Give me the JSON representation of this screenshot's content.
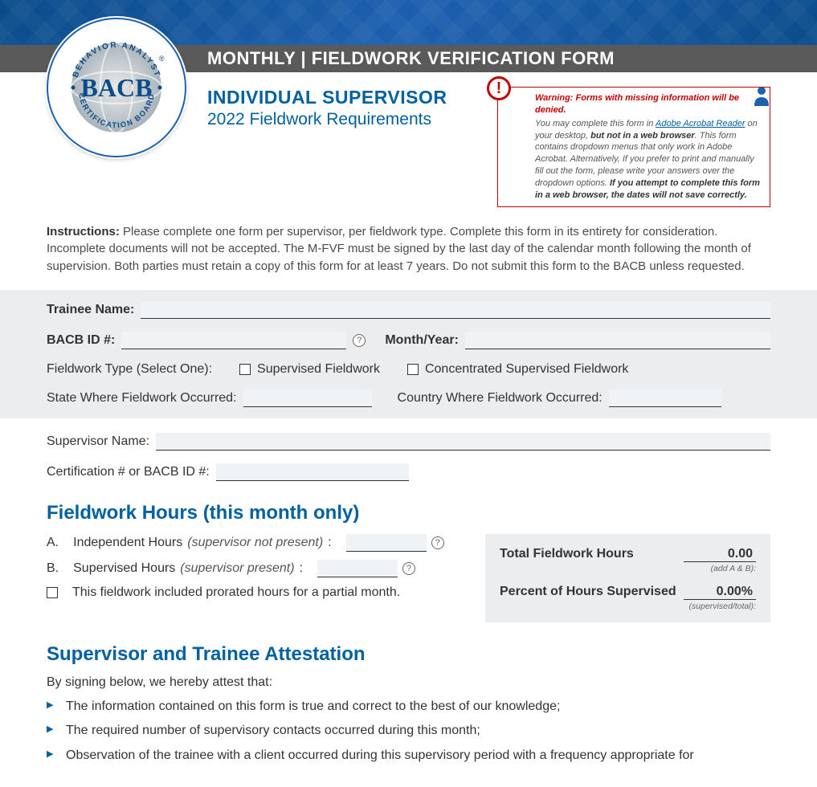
{
  "header": {
    "band_title": "MONTHLY | FIELDWORK VERIFICATION FORM",
    "logo_top": "BEHAVIOR ANALYST",
    "logo_center": "BACB",
    "logo_bottom": "CERTIFICATION BOARD",
    "logo_reg": "®",
    "subtitle1": "INDIVIDUAL SUPERVISOR",
    "subtitle2": "2022 Fieldwork Requirements"
  },
  "warning": {
    "icon_glyph": "!",
    "title": "Warning: Forms with missing information will be denied.",
    "line1a": "You may complete this form in ",
    "link_text": "Adobe Acrobat Reader",
    "line1b": " on your desktop, ",
    "bold1": "but not in a web browser",
    "line1c": ". This form contains dropdown menus that only work in Adobe Acrobat. Alternatively, If you prefer to print and manually fill out the form, please write your answers over the dropdown options. ",
    "bold2": "If you attempt to complete this form in a web browser, the dates will not save correctly."
  },
  "instructions": {
    "label": "Instructions:",
    "text": " Please complete one form per supervisor, per fieldwork type. Complete this form in its entirety for consideration. Incomplete documents will not be accepted. The M-FVF must be signed by the last day of the calendar month following the month of supervision. Both parties must retain a copy of this form for at least 7 years. Do not submit this form to the BACB unless requested."
  },
  "fields": {
    "trainee_name_label": "Trainee Name:",
    "bacb_id_label": "BACB ID #:",
    "month_year_label": "Month/Year:",
    "fieldwork_type_label": "Fieldwork Type (Select One):",
    "opt_supervised": "Supervised Fieldwork",
    "opt_concentrated": "Concentrated Supervised Fieldwork",
    "state_label": "State Where Fieldwork Occurred:",
    "country_label": "Country Where Fieldwork Occurred:",
    "supervisor_name_label": "Supervisor Name:",
    "cert_label": "Certification # or BACB ID #:",
    "help_glyph": "?"
  },
  "hours": {
    "heading": "Fieldwork Hours (this month only)",
    "a_letter": "A.",
    "a_label": "Independent Hours ",
    "a_note": "(supervisor not present)",
    "a_colon": ":",
    "b_letter": "B.",
    "b_label": "Supervised Hours ",
    "b_note": "(supervisor present)",
    "b_colon": ":",
    "prorated": "This fieldwork included prorated hours for a partial month.",
    "total_label": "Total Fieldwork Hours",
    "total_value": "0.00",
    "total_note": "(add A & B):",
    "percent_label": "Percent of Hours Supervised",
    "percent_value": "0.00%",
    "percent_note": "(supervised/total):"
  },
  "attestation": {
    "heading": "Supervisor and Trainee Attestation",
    "intro": "By signing below, we hereby attest that:",
    "items": [
      "The information contained on this form is true and correct to the best of our knowledge;",
      "The required number of supervisory contacts occurred during this month;",
      "Observation of the trainee with a client occurred during this supervisory period with a frequency appropriate for"
    ]
  }
}
